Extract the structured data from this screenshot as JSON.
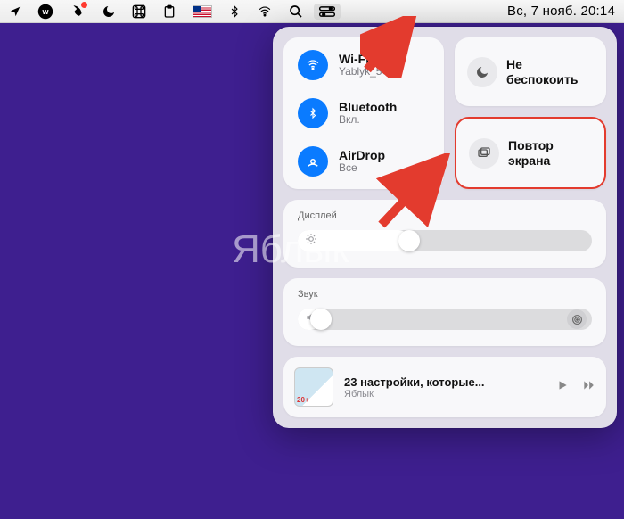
{
  "menubar": {
    "clock": "Вс, 7 нояб.  20:14"
  },
  "control_center": {
    "connectivity": {
      "wifi": {
        "title": "Wi-Fi",
        "sub": "Yablyk_5G"
      },
      "bluetooth": {
        "title": "Bluetooth",
        "sub": "Вкл."
      },
      "airdrop": {
        "title": "AirDrop",
        "sub": "Все"
      }
    },
    "dnd": {
      "label_line1": "Не",
      "label_line2": "беспокоить"
    },
    "screen_mirror": {
      "label_line1": "Повтор",
      "label_line2": "экрана"
    },
    "display": {
      "title": "Дисплей",
      "value_pct": 38
    },
    "sound": {
      "title": "Звук",
      "value_pct": 8
    },
    "now_playing": {
      "title": "23 настройки, которые...",
      "source": "Яблык"
    }
  },
  "watermark": "Яблык"
}
